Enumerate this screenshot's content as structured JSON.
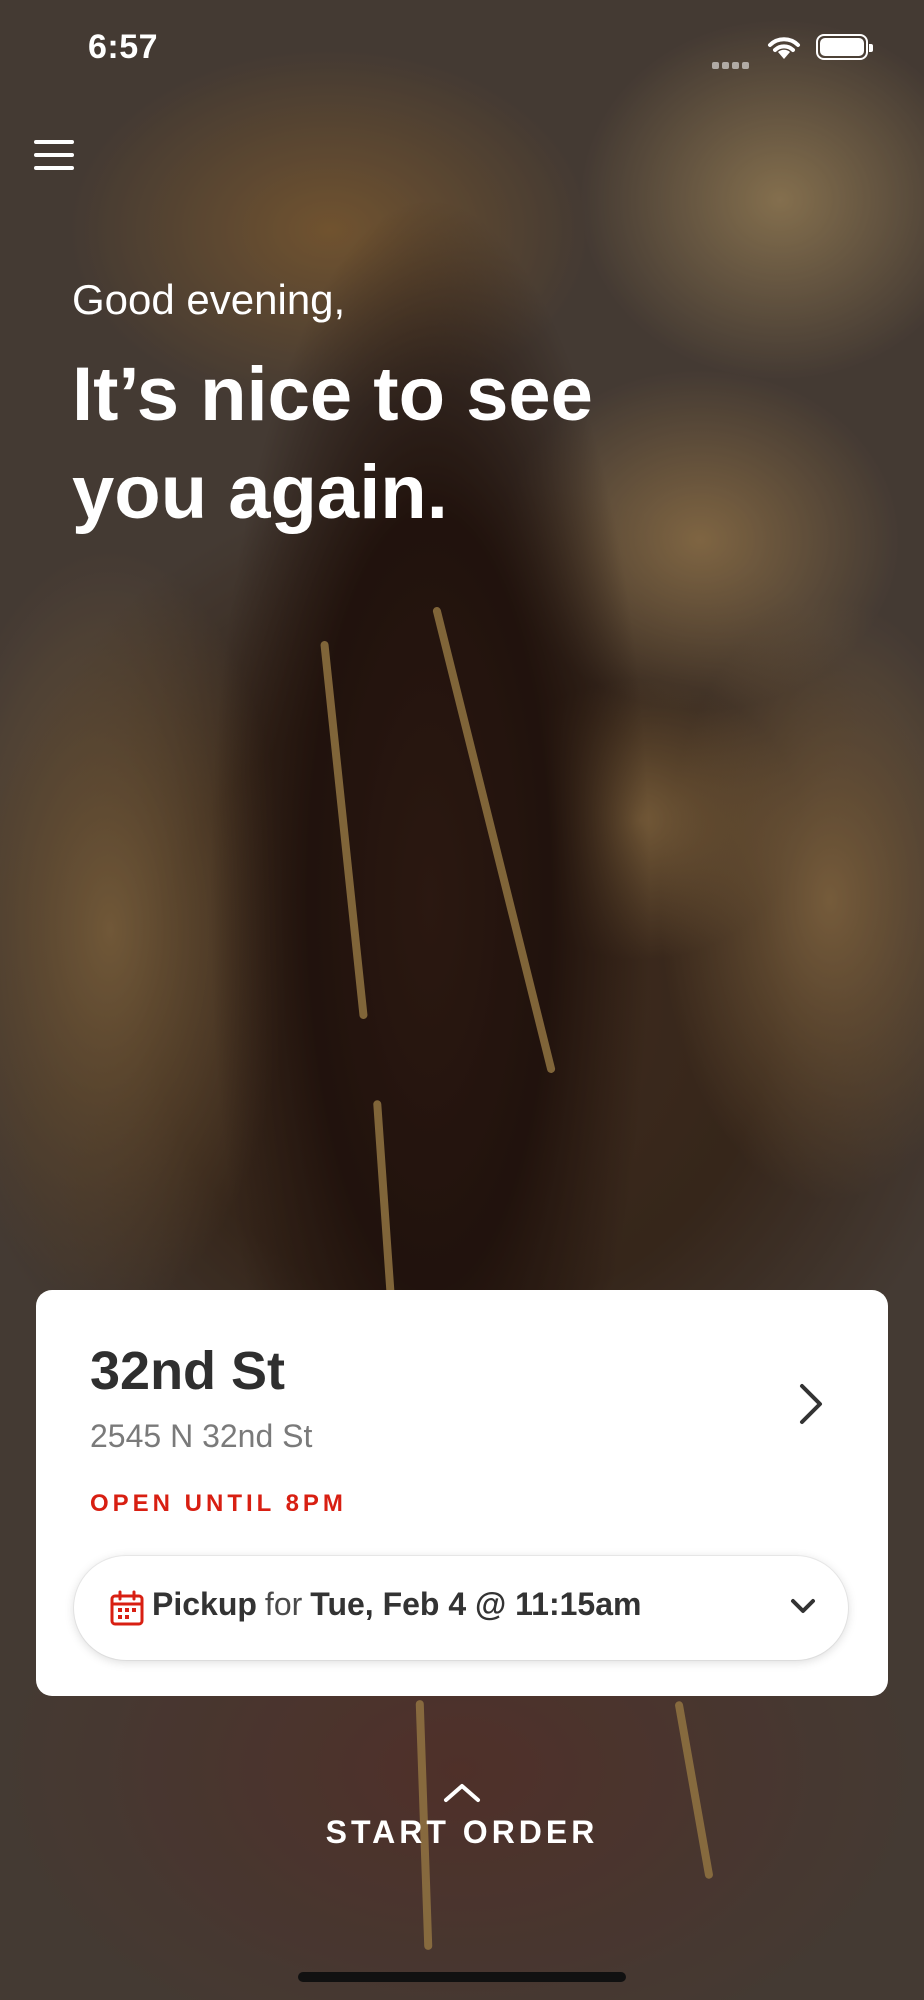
{
  "status_bar": {
    "time": "6:57"
  },
  "greeting": {
    "salutation": "Good evening,",
    "headline": "It’s nice to see you again."
  },
  "location": {
    "name": "32nd St",
    "address": "2545 N 32nd St",
    "status": "OPEN UNTIL 8PM",
    "status_color": "#d81f12"
  },
  "pickup": {
    "mode": "Pickup",
    "connector": "for",
    "datetime": "Tue, Feb 4 @ 11:15am",
    "icon": "calendar-icon"
  },
  "cta": {
    "label": "START ORDER"
  }
}
